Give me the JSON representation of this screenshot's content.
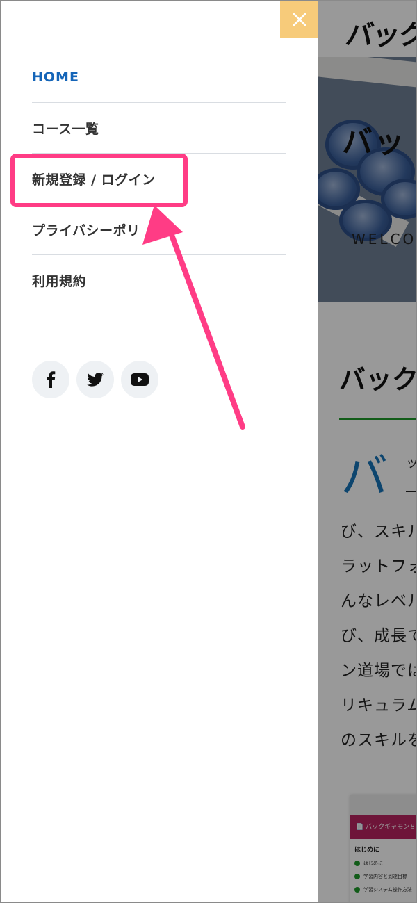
{
  "drawer": {
    "close_label": "×",
    "nav_items": [
      {
        "label": "HOME",
        "active": true
      },
      {
        "label": "コース一覧"
      },
      {
        "label": "新規登録 / ログイン"
      },
      {
        "label": "プライバシーポリ"
      },
      {
        "label": "利用規約"
      }
    ],
    "social_icons": [
      "facebook-icon",
      "twitter-icon",
      "youtube-icon"
    ]
  },
  "background_page": {
    "logo": "バック",
    "hero_title": "バッ",
    "hero_subtitle": "WELCO",
    "section_heading": "バック",
    "big_char": "バ",
    "small_char": "ッ",
    "body_lines": [
      "び、スキル",
      "ラットフォ",
      "んなレベル",
      "び、成長で",
      "ン道場では",
      "リキュラム",
      "のスキルを"
    ],
    "card": {
      "bar_label": "📄 バックギャモン８級",
      "section": "はじめに",
      "items": [
        "はじめに",
        "学習内容と到達目標",
        "学習システム操作方法"
      ]
    }
  },
  "colors": {
    "accent_blue": "#1565b8",
    "close_bg": "#f7cb7a",
    "highlight": "#ff3c85",
    "green_rule": "#1e9a2a"
  }
}
